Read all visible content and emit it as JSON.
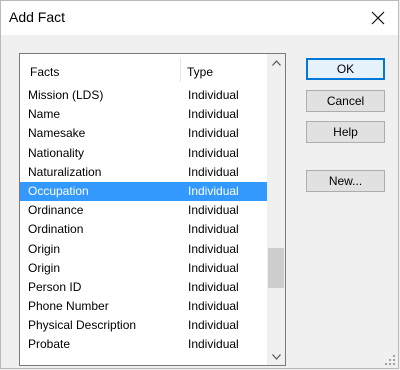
{
  "dialog": {
    "title": "Add Fact",
    "close_icon": "close-icon"
  },
  "list": {
    "headers": {
      "facts": "Facts",
      "type": "Type"
    },
    "rows": [
      {
        "fact": "Mission (LDS)",
        "type": "Individual",
        "selected": false
      },
      {
        "fact": "Name",
        "type": "Individual",
        "selected": false
      },
      {
        "fact": "Namesake",
        "type": "Individual",
        "selected": false
      },
      {
        "fact": "Nationality",
        "type": "Individual",
        "selected": false
      },
      {
        "fact": "Naturalization",
        "type": "Individual",
        "selected": false
      },
      {
        "fact": "Occupation",
        "type": "Individual",
        "selected": true
      },
      {
        "fact": "Ordinance",
        "type": "Individual",
        "selected": false
      },
      {
        "fact": "Ordination",
        "type": "Individual",
        "selected": false
      },
      {
        "fact": "Origin",
        "type": "Individual",
        "selected": false
      },
      {
        "fact": "Origin",
        "type": "Individual",
        "selected": false
      },
      {
        "fact": "Person ID",
        "type": "Individual",
        "selected": false
      },
      {
        "fact": "Phone Number",
        "type": "Individual",
        "selected": false
      },
      {
        "fact": "Physical Description",
        "type": "Individual",
        "selected": false
      },
      {
        "fact": "Probate",
        "type": "Individual",
        "selected": false
      }
    ],
    "scroll_up_icon": "chevron-up-icon",
    "scroll_down_icon": "chevron-down-icon"
  },
  "buttons": {
    "ok": "OK",
    "cancel": "Cancel",
    "help": "Help",
    "new": "New..."
  },
  "colors": {
    "selection": "#3399ff",
    "default_button_border": "#0078d7"
  }
}
